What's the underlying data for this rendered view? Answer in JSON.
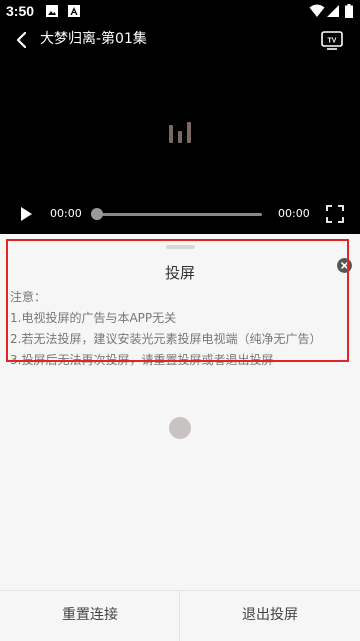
{
  "status_bar": {
    "time": "3:50",
    "left_icons": [
      "image-icon",
      "font-icon"
    ],
    "right_icons": [
      "wifi-icon",
      "signal-icon",
      "battery-icon"
    ]
  },
  "player": {
    "title": "大梦归离-第01集",
    "current_time": "00:00",
    "total_time": "00:00",
    "progress": 0,
    "icons": [
      "back-icon",
      "tv-cast-icon",
      "loading-bars-icon",
      "play-icon",
      "fullscreen-icon"
    ]
  },
  "cast_panel": {
    "title": "投屏",
    "notice_heading": "注意：",
    "notices": [
      "1.电视投屏的广告与本APP无关",
      "2.若无法投屏，建议安装光元素投屏电视端（纯净无广告）",
      "3.投屏后无法再次投屏，请重置投屏或者退出投屏"
    ],
    "highlight_color": "#e42323"
  },
  "bottom_bar": {
    "reset_label": "重置连接",
    "exit_label": "退出投屏"
  }
}
